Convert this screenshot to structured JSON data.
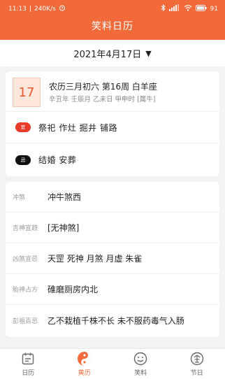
{
  "status_bar": {
    "time": "11:13",
    "speed": "240K/s",
    "battery": "91"
  },
  "app": {
    "title": "笑料日历"
  },
  "date_selector": {
    "label": "2021年4月17日",
    "caret": "▼"
  },
  "day_card": {
    "day_number": "17",
    "lunar": "农历三月初六 第16周 白羊座",
    "ganzhi": "辛丑年 壬辰月 乙未日 甲申时 [属牛]",
    "yi": {
      "badge": "宜",
      "text": "祭祀 作灶 掘井 铺路"
    },
    "ji": {
      "badge": "忌",
      "text": "结婚 安葬"
    }
  },
  "details": [
    {
      "label": "冲煞",
      "value": "冲牛煞西"
    },
    {
      "label": "吉神宜趋",
      "value": "[无神煞]"
    },
    {
      "label": "凶煞宜忌",
      "value": "天罡 死神 月煞 月虚 朱雀"
    },
    {
      "label": "胎神占方",
      "value": "碓磨厕房内北"
    },
    {
      "label": "彭祖百忌",
      "value": "乙不栽植千株不长 未不服药毒气入肠"
    }
  ],
  "tabs": [
    {
      "label": "日历",
      "icon": "calendar-icon"
    },
    {
      "label": "黄历",
      "icon": "yinyang-icon"
    },
    {
      "label": "笑料",
      "icon": "smile-icon"
    },
    {
      "label": "节日",
      "icon": "festival-icon"
    }
  ],
  "colors": {
    "accent": "#f26a3a",
    "yi": "#ea3a2a",
    "ji": "#111111"
  }
}
